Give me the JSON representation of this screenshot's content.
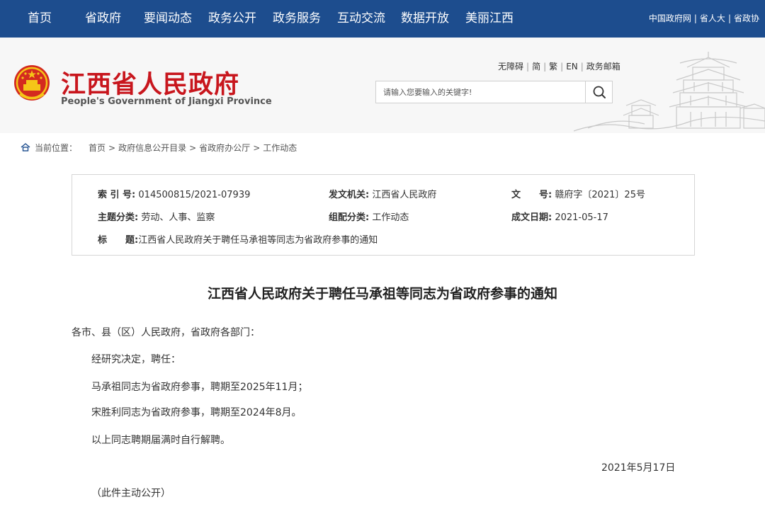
{
  "topnav": {
    "items": [
      "首页",
      "省政府",
      "要闻动态",
      "政务公开",
      "政务服务",
      "互动交流",
      "数据开放",
      "美丽江西"
    ],
    "right_links": [
      "中国政府网",
      "省人大",
      "省政协"
    ]
  },
  "header": {
    "title": "江西省人民政府",
    "subtitle": "People's Government of Jiangxi Province",
    "util_links": [
      "无障碍",
      "简",
      "繁",
      "EN",
      "政务邮箱"
    ],
    "search_placeholder": "请输入您要输入的关键字!"
  },
  "breadcrumb": {
    "label": "当前位置：",
    "items": [
      "首页",
      "政府信息公开目录",
      "省政府办公厅",
      "工作动态"
    ]
  },
  "meta": {
    "index_label": "索 引 号:",
    "index_value": "014500815/2021-07939",
    "issuer_label": "发文机关:",
    "issuer_value": "江西省人民政府",
    "docno_label": "文　　号:",
    "docno_value": "赣府字〔2021〕25号",
    "topic_label": "主题分类:",
    "topic_value": "劳动、人事、监察",
    "category_label": "组配分类:",
    "category_value": "工作动态",
    "date_label": "成文日期:",
    "date_value": "2021-05-17",
    "title_label": "标　　题:",
    "title_value": "江西省人民政府关于聘任马承祖等同志为省政府参事的通知"
  },
  "document": {
    "title": "江西省人民政府关于聘任马承祖等同志为省政府参事的通知",
    "salutation": "各市、县（区）人民政府，省政府各部门：",
    "paragraphs": [
      "经研究决定，聘任：",
      "马承祖同志为省政府参事，聘期至2025年11月；",
      "宋胜利同志为省政府参事，聘期至2024年8月。",
      "以上同志聘期届满时自行解聘。"
    ],
    "date": "2021年5月17日",
    "note": "（此件主动公开）"
  },
  "colors": {
    "nav_bg": "#1d4d8e",
    "title_red": "#c8161d",
    "header_bg": "#f7f7f7"
  }
}
